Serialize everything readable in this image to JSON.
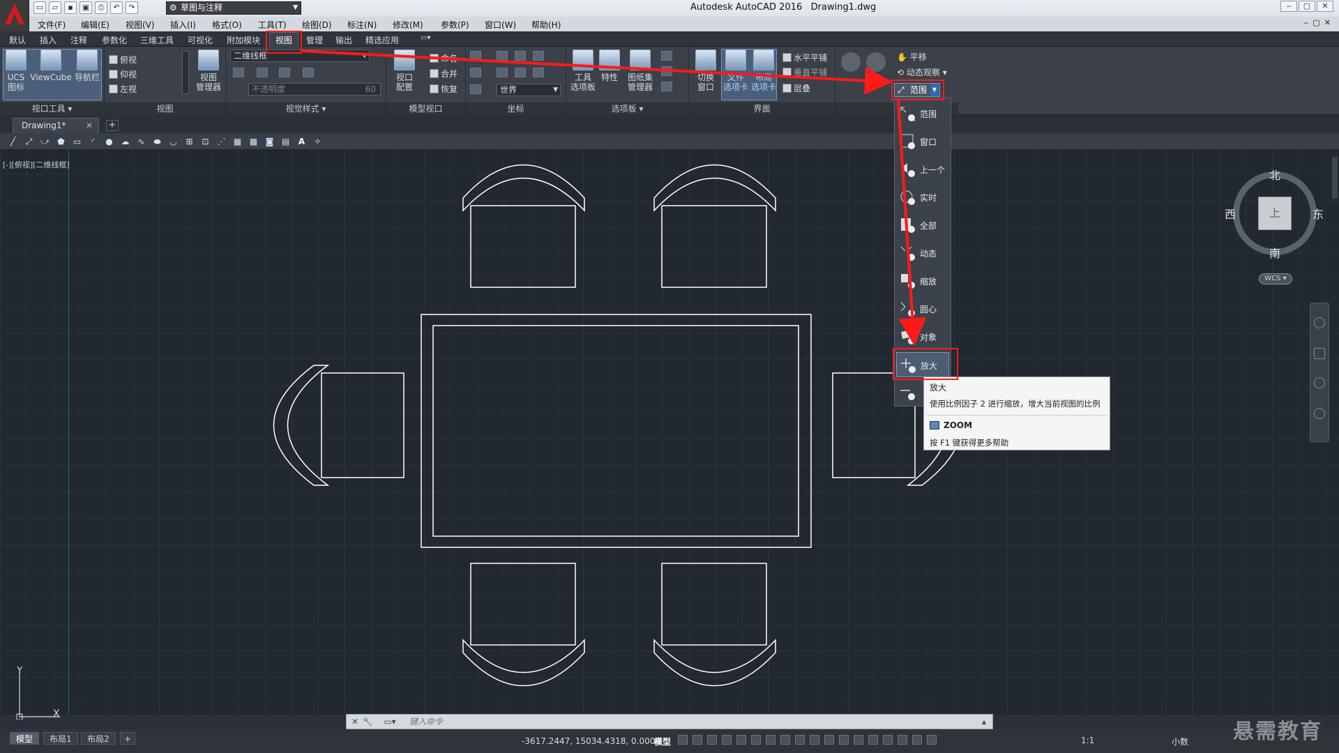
{
  "title": {
    "app": "Autodesk AutoCAD 2016",
    "file": "Drawing1.dwg",
    "workspace": "草图与注释"
  },
  "menus": [
    "文件(F)",
    "编辑(E)",
    "视图(V)",
    "插入(I)",
    "格式(O)",
    "工具(T)",
    "绘图(D)",
    "标注(N)",
    "修改(M)",
    "参数(P)",
    "窗口(W)",
    "帮助(H)"
  ],
  "ribbon_tabs": [
    "默认",
    "插入",
    "注释",
    "参数化",
    "三维工具",
    "可视化",
    "附加模块",
    "视图",
    "管理",
    "输出",
    "精选应用"
  ],
  "active_tab": "视图",
  "panels": {
    "viewport_tools": {
      "title": "视口工具",
      "ucs_label_1": "UCS",
      "ucs_label_2": "图标",
      "viewcube": "ViewCube",
      "navbar": "导航栏"
    },
    "views": {
      "title": "视图",
      "items": [
        "俯视",
        "仰视",
        "左视"
      ],
      "manager_1": "视图",
      "manager_2": "管理器"
    },
    "visual_styles": {
      "title": "视觉样式",
      "style": "二维线框",
      "opacity_placeholder": "不透明度",
      "opacity_value": "60"
    },
    "model_viewports": {
      "title": "模型视口",
      "config_1": "视口",
      "config_2": "配置",
      "items": [
        "命名",
        "合并",
        "恢复"
      ]
    },
    "coordinates": {
      "title": "坐标",
      "world": "世界"
    },
    "palettes": {
      "title": "选项板",
      "tool_1": "工具",
      "tool_2": "选项板",
      "props": "特性",
      "sheet_1": "图纸集",
      "sheet_2": "管理器"
    },
    "interface": {
      "title": "界面",
      "switch_1": "切换",
      "switch_2": "窗口",
      "filetab_1": "文件",
      "filetab_2": "选项卡",
      "layouttab_1": "布局",
      "layouttab_2": "选项卡",
      "htile": "水平平铺",
      "vtile": "垂直平铺",
      "cascade": "层叠"
    },
    "navigate": {
      "pan": "平移",
      "orbit": "动态观察",
      "zoom": "范围"
    }
  },
  "file_tab": "Drawing1*",
  "viewport_label": "[-][俯视][二维线框]",
  "zoom_menu": [
    "范围",
    "窗口",
    "上一个",
    "实时",
    "全部",
    "动态",
    "缩放",
    "圆心",
    "对象",
    "放大",
    "缩小"
  ],
  "tooltip": {
    "title": "放大",
    "desc": "使用比例因子 2 进行缩放，增大当前视图的比例",
    "command": "ZOOM",
    "help": "按 F1 键获得更多帮助"
  },
  "viewcube": {
    "north": "北",
    "south": "南",
    "east": "东",
    "west": "西",
    "face": "上",
    "wcs": "WCS"
  },
  "command_placeholder": "键入命令",
  "layout_tabs": [
    "模型",
    "布局1",
    "布局2"
  ],
  "status": {
    "coords": "-3617.2447, 15034.4318, 0.0000",
    "model": "模型",
    "scale": "1:1",
    "units": "小数"
  },
  "watermark": "悬需教育",
  "ucs_axes": {
    "x": "X",
    "y": "Y"
  },
  "colors": {
    "annotation": "#ff1a1a",
    "canvas": "#212830",
    "grid": "#2b323c",
    "drawing_lines": "#ffffff"
  }
}
